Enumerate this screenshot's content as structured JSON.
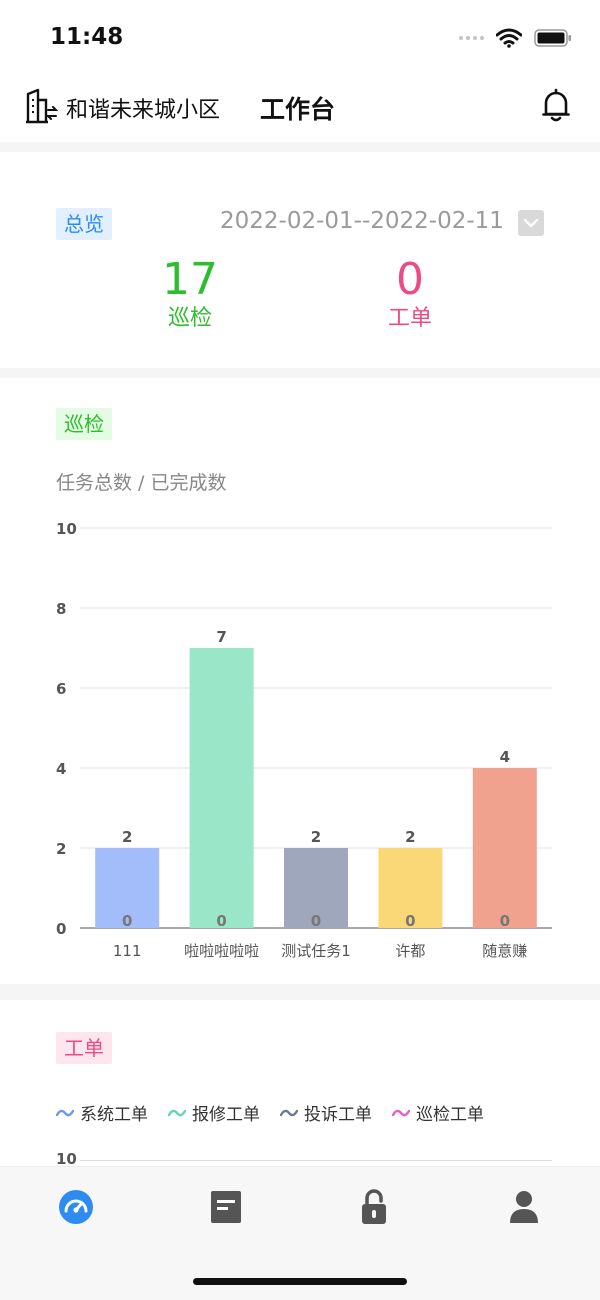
{
  "status_bar": {
    "time": "11:48"
  },
  "header": {
    "community": "和谐未来城小区",
    "title": "工作台"
  },
  "overview": {
    "tag": "总览",
    "date_range": "2022-02-01--2022-02-11",
    "stats": [
      {
        "value": "17",
        "label": "巡检",
        "color": "#2ebd2e"
      },
      {
        "value": "0",
        "label": "工单",
        "color": "#ec4b86"
      }
    ]
  },
  "patrol": {
    "tag": "巡检",
    "subtitle": "任务总数 / 已完成数",
    "chart_data": {
      "type": "bar",
      "categories": [
        "111",
        "啦啦啦啦啦",
        "测试任务1",
        "许都",
        "随意赚"
      ],
      "series": [
        {
          "values": [
            2,
            7,
            2,
            2,
            4
          ],
          "colors": [
            "#a2bdf9",
            "#9ae6c9",
            "#9ea7bb",
            "#fad878",
            "#f0a28f"
          ]
        },
        {
          "values": [
            0,
            0,
            0,
            0,
            0
          ]
        }
      ],
      "ylim": [
        0,
        10
      ],
      "yticks": [
        0,
        2,
        4,
        6,
        8,
        10
      ],
      "grid": true
    }
  },
  "orders": {
    "tag": "工单",
    "legend": [
      {
        "label": "系统工单",
        "color": "#6d97ee"
      },
      {
        "label": "报修工单",
        "color": "#5ed6b7"
      },
      {
        "label": "投诉工单",
        "color": "#6b7791"
      },
      {
        "label": "巡检工单",
        "color": "#e35fc6"
      }
    ],
    "y_first_tick": "10"
  },
  "tabbar": {
    "items": [
      {
        "icon": "dashboard-icon",
        "active": true,
        "color": "#2e8cf0"
      },
      {
        "icon": "document-icon",
        "active": false,
        "color": "#555555"
      },
      {
        "icon": "unlock-icon",
        "active": false,
        "color": "#555555"
      },
      {
        "icon": "user-icon",
        "active": false,
        "color": "#555555"
      }
    ]
  }
}
